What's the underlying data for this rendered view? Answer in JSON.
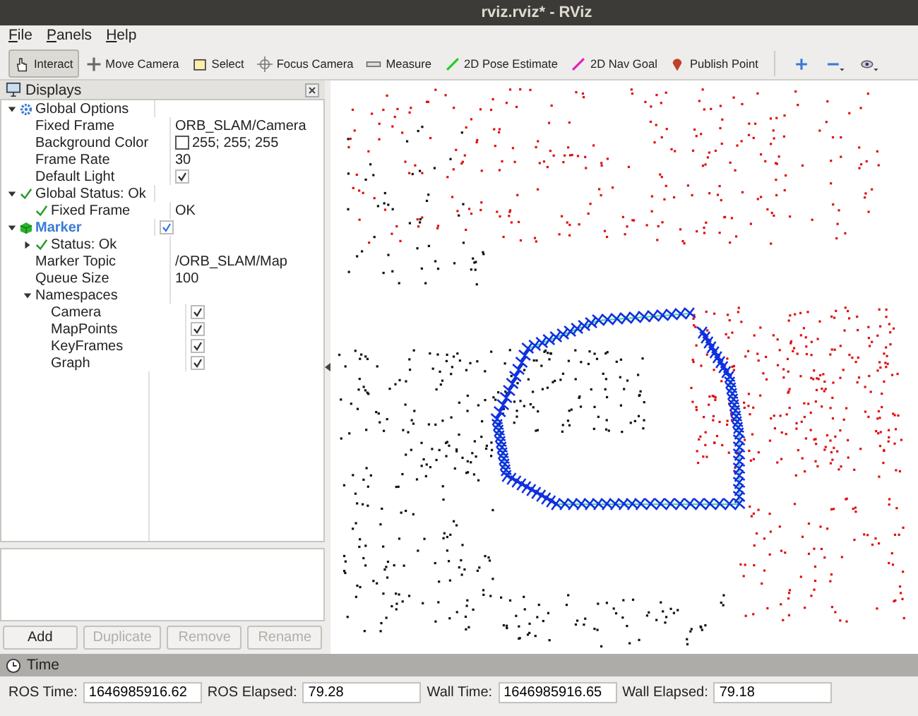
{
  "window": {
    "title": "rviz.rviz* - RViz"
  },
  "menu": [
    {
      "label": "File"
    },
    {
      "label": "Panels"
    },
    {
      "label": "Help"
    }
  ],
  "toolbar": [
    {
      "label": "Interact",
      "kind": "hand",
      "selected": true
    },
    {
      "label": "Move Camera",
      "kind": "move",
      "selected": false
    },
    {
      "label": "Select",
      "kind": "select",
      "selected": false
    },
    {
      "label": "Focus Camera",
      "kind": "focus",
      "selected": false
    },
    {
      "label": "Measure",
      "kind": "ruler",
      "selected": false
    },
    {
      "label": "2D Pose Estimate",
      "kind": "pose",
      "selected": false
    },
    {
      "label": "2D Nav Goal",
      "kind": "goal",
      "selected": false
    },
    {
      "label": "Publish Point",
      "kind": "pin",
      "selected": false
    }
  ],
  "displays": {
    "title": "Displays",
    "items": [
      {
        "label": "Global Options",
        "kind": "group",
        "expanded": true,
        "children": [
          {
            "label": "Fixed Frame",
            "kind": "text",
            "value": "ORB_SLAM/Camera"
          },
          {
            "label": "Background Color",
            "kind": "color",
            "value": "255; 255; 255"
          },
          {
            "label": "Frame Rate",
            "kind": "text",
            "value": "30"
          },
          {
            "label": "Default Light",
            "kind": "checkbox",
            "checked": true
          }
        ]
      },
      {
        "label": "Global Status: Ok",
        "kind": "status",
        "expanded": true,
        "children": [
          {
            "label": "Fixed Frame",
            "kind": "status",
            "value": "OK"
          }
        ]
      },
      {
        "label": "Marker",
        "kind": "display",
        "expanded": true,
        "checked": true,
        "children": [
          {
            "label": "Status: Ok",
            "kind": "status",
            "expanded": false
          },
          {
            "label": "Marker Topic",
            "kind": "text",
            "value": "/ORB_SLAM/Map"
          },
          {
            "label": "Queue Size",
            "kind": "text",
            "value": "100"
          },
          {
            "label": "Namespaces",
            "kind": "text",
            "expanded": true,
            "children": [
              {
                "label": "Camera",
                "kind": "checkbox",
                "checked": true
              },
              {
                "label": "MapPoints",
                "kind": "checkbox",
                "checked": true
              },
              {
                "label": "KeyFrames",
                "kind": "checkbox",
                "checked": true
              },
              {
                "label": "Graph",
                "kind": "checkbox",
                "checked": true
              }
            ]
          }
        ]
      }
    ],
    "buttons": [
      {
        "label": "Add",
        "disabled": false
      },
      {
        "label": "Duplicate",
        "disabled": true
      },
      {
        "label": "Remove",
        "disabled": true
      },
      {
        "label": "Rename",
        "disabled": true
      }
    ]
  },
  "time": {
    "title": "Time",
    "fields": [
      {
        "label": "ROS Time:",
        "value": "1646985916.62"
      },
      {
        "label": "ROS Elapsed:",
        "value": "79.28"
      },
      {
        "label": "Wall Time:",
        "value": "1646985916.65"
      },
      {
        "label": "Wall Elapsed:",
        "value": "79.18"
      }
    ]
  }
}
